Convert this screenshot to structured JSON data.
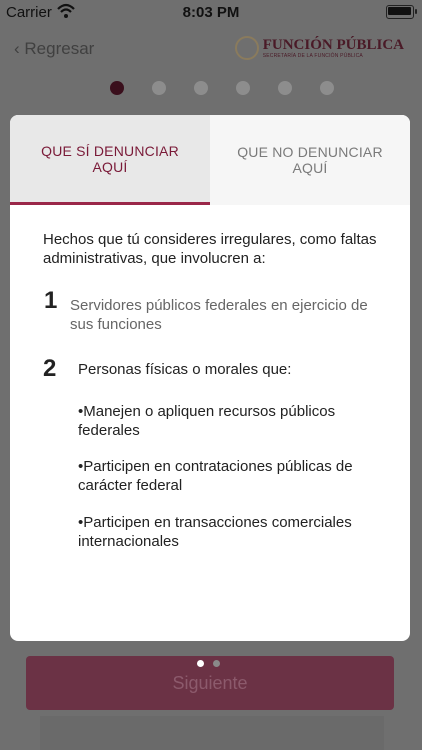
{
  "status_bar": {
    "carrier": "Carrier",
    "time": "8:03 PM",
    "battery_level": 0.95
  },
  "nav": {
    "back_label": "Regresar",
    "brand_name": "FUNCIÓN PÚBLICA",
    "brand_sub": "SECRETARÍA DE LA FUNCIÓN PÚBLICA"
  },
  "progress": {
    "total": 6,
    "current": 1
  },
  "modal": {
    "tabs": [
      {
        "label": "QUE SÍ DENUNCIAR AQUÍ"
      },
      {
        "label": "QUE NO DENUNCIAR AQUÍ"
      }
    ],
    "intro": "Hechos que tú consideres irregulares, como faltas administrativas, que involucren a:",
    "items": [
      {
        "number": "1",
        "text": "Servidores públicos federales en ejercicio de sus funciones"
      },
      {
        "number": "2",
        "text": "Personas físicas o morales que:"
      }
    ],
    "bullets": [
      "•Manejen o apliquen recursos públicos federales",
      "•Participen en contrataciones públicas de carácter federal",
      "•Participen en transacciones comerciales internacionales"
    ]
  },
  "pager": {
    "total": 2,
    "current": 1
  },
  "footer": {
    "next_label": "Siguiente"
  }
}
